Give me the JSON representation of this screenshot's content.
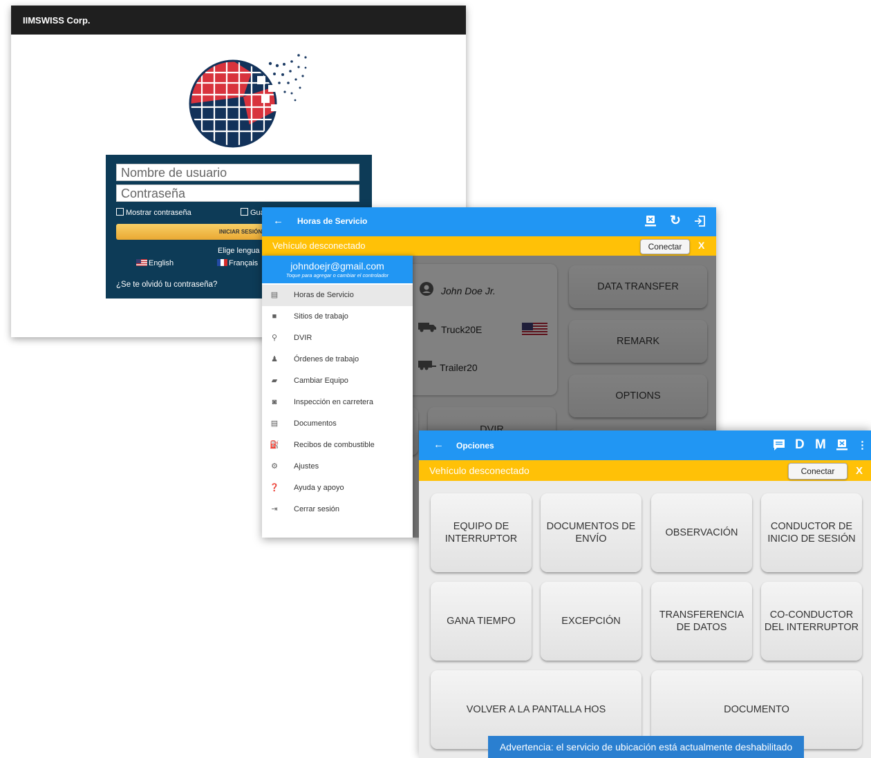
{
  "login": {
    "company": "IIMSWISS Corp.",
    "username_placeholder": "Nombre de usuario",
    "password_placeholder": "Contraseña",
    "show_password": "Mostrar contraseña",
    "save_partial": "Gua",
    "login_button": "INICIAR SESIÓN",
    "choose_language": "Elige lengua",
    "lang_english": "English",
    "lang_french": "Français",
    "forgot_password": "¿Se te olvidó tu contraseña?"
  },
  "hos": {
    "title": "Horas de Servicio",
    "vehicle_status": "Vehículo desconectado",
    "connect": "Conectar",
    "close": "X",
    "driver_name": "John Doe Jr.",
    "truck": "Truck20E",
    "trailer": "Trailer20",
    "buttons": [
      "DATA TRANSFER",
      "REMARK",
      "OPTIONS",
      "DVIR"
    ],
    "drawer": {
      "email": "johndoejr@gmail.com",
      "hint": "Toque para agregar o cambiar el controlador",
      "items": [
        {
          "label": "Horas de Servicio",
          "icon": "clipboard-icon"
        },
        {
          "label": "Sitios de trabajo",
          "icon": "briefcase-icon"
        },
        {
          "label": "DVIR",
          "icon": "search-icon"
        },
        {
          "label": "Órdenes de trabajo",
          "icon": "worker-icon"
        },
        {
          "label": "Cambiar Equipo",
          "icon": "truck-icon"
        },
        {
          "label": "Inspección en carretera",
          "icon": "inspection-icon"
        },
        {
          "label": "Documentos",
          "icon": "document-icon"
        },
        {
          "label": "Recibos de combustible",
          "icon": "fuel-icon"
        },
        {
          "label": "Ajustes",
          "icon": "gear-icon"
        },
        {
          "label": "Ayuda y apoyo",
          "icon": "help-icon"
        },
        {
          "label": "Cerrar sesión",
          "icon": "logout-icon"
        }
      ]
    }
  },
  "options": {
    "title": "Opciones",
    "vehicle_status": "Vehículo desconectado",
    "connect": "Conectar",
    "close": "X",
    "toolbar_d": "D",
    "toolbar_m": "M",
    "buttons": {
      "b1": [
        "EQUIPO DE",
        "INTERRUPTOR"
      ],
      "b2": [
        "DOCUMENTOS DE",
        "ENVÍO"
      ],
      "b3": [
        "OBSERVACIÓN"
      ],
      "b4": [
        "CONDUCTOR DE",
        "INICIO DE SESIÓN"
      ],
      "b5": [
        "GANA TIEMPO"
      ],
      "b6": [
        "EXCEPCIÓN"
      ],
      "b7": [
        "TRANSFERENCIA",
        "DE DATOS"
      ],
      "b8": [
        "CO-CONDUCTOR",
        "DEL INTERRUPTOR"
      ],
      "b9": [
        "VOLVER A LA PANTALLA HOS"
      ],
      "b10": [
        "DOCUMENTO"
      ]
    },
    "warning": "Advertencia: el servicio de ubicación está actualmente deshabilitado"
  },
  "colors": {
    "appbar": "#2196f3",
    "warnbar": "#ffc107",
    "login_panel": "#0d3b57",
    "login_button": "#f2bb4a"
  }
}
